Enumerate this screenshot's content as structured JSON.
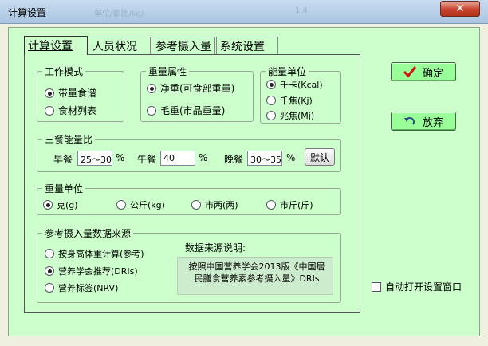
{
  "window": {
    "title": "计算设置",
    "close_label": "✕",
    "ghost_a": "单位/都比/kg/",
    "ghost_b": "1.4"
  },
  "tabs": [
    "计算设置",
    "人员状况",
    "参考摄入量",
    "系统设置"
  ],
  "work_mode": {
    "label": "工作模式",
    "options": [
      "带量食谱",
      "食材列表"
    ],
    "selected": 0
  },
  "weight_attr": {
    "label": "重量属性",
    "options": [
      "净重(可食部重量)",
      "毛重(市品重量)"
    ],
    "selected": 0
  },
  "energy_unit": {
    "label": "能量单位",
    "options": [
      "千卡(Kcal)",
      "千焦(Kj)",
      "兆焦(Mj)"
    ],
    "selected": 0
  },
  "meal_ratio": {
    "label": "三餐能量比",
    "breakfast_label": "早餐",
    "breakfast_value": "25～30",
    "breakfast_unit": "%",
    "lunch_label": "午餐",
    "lunch_value": "40",
    "lunch_unit": "%",
    "dinner_label": "晚餐",
    "dinner_value": "30～35",
    "dinner_unit": "%",
    "default_button": "默认"
  },
  "weight_unit": {
    "label": "重量单位",
    "options": [
      "克(g)",
      "公斤(kg)",
      "市两(两)",
      "市斤(斤)"
    ],
    "selected": 0
  },
  "intake_source": {
    "label": "参考摄入量数据来源",
    "options": [
      "按身高体重计算(参考)",
      "营养学会推荐(DRIs)",
      "营养标签(NRV)"
    ],
    "selected": 1,
    "desc_title": "数据来源说明:",
    "desc_text": "按照中国营养学会2013版《中国居民膳食营养素参考摄入量》DRIs"
  },
  "buttons": {
    "ok": "确定",
    "cancel": "放弃"
  },
  "auto_open": {
    "label": "自动打开设置窗口",
    "checked": false
  }
}
